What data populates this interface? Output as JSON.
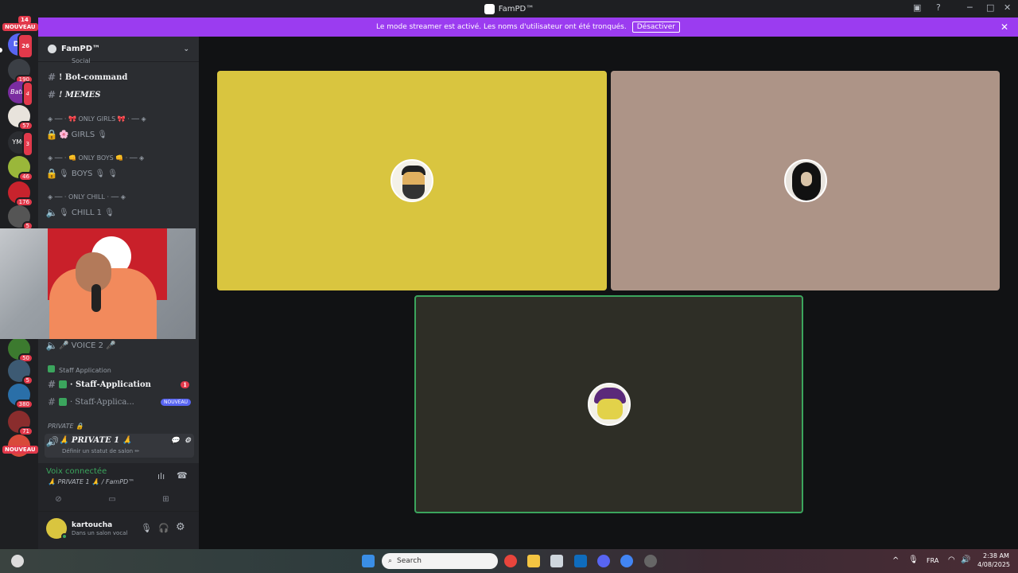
{
  "window": {
    "title": "FamPD™"
  },
  "banner": {
    "message": "Le mode streamer est activé. Les noms d'utilisateur ont été tronqués.",
    "disable_label": "Désactiver",
    "color": "#9b3cf0"
  },
  "servers": {
    "top_badge": "14",
    "nouveau_label": "NOUVEAU",
    "icons": [
      {
        "label": "DR",
        "badge": "26"
      },
      {
        "label": "",
        "badge": "190"
      },
      {
        "label": "Batra",
        "badge": "4"
      },
      {
        "label": "",
        "badge": "57"
      },
      {
        "label": "YMC",
        "badge": "3"
      },
      {
        "label": "",
        "badge": "46"
      },
      {
        "label": "",
        "badge": "176"
      },
      {
        "label": "",
        "badge": "5"
      },
      {
        "label": "",
        "badge": "50"
      },
      {
        "label": "",
        "badge": "5"
      },
      {
        "label": "",
        "badge": "380"
      },
      {
        "label": "",
        "badge": "71"
      }
    ],
    "bottom_nouveau": "NOUVEAU"
  },
  "guild": {
    "name": "FamPD™"
  },
  "channels": {
    "top_cut": "Social",
    "bot_command": "! Bot-command",
    "memes": "! MEMES",
    "cat_only_girls": "◈ ── · 🎀 ONLY GIRLS 🎀 · ── ◈",
    "girls": "🌸 GIRLS 🎙",
    "cat_only_boys": "◈ ── · 👊 ONLY BOYS 👊 · ── ◈",
    "boys": "🎙 BOYS 🎙 🎙",
    "cat_only_chill": "◈ ── · ONLY CHILL · ── ◈",
    "chill1": "🎙 CHILL 1 🎙",
    "voice2": "🎤 VOICE 2 🎤",
    "cat_staff": "Staff Application",
    "staff_app": "· Staff-Application",
    "staff_app_badge": "1",
    "staff_app2": "· Staff-Applica...",
    "staff_app2_tag": "NOUVEAU",
    "cat_private": "PRIVATE 🔒",
    "private1": "🙏 PRIVATE 1 🙏",
    "private1_status": "Définir un statut de salon ✏"
  },
  "voice": {
    "status": "Voix connectée",
    "channel": "🙏 PRIVATE 1 🙏 / FamPD™"
  },
  "user": {
    "name": "kartoucha",
    "status": "Dans un salon vocal"
  },
  "tiles": [
    {
      "color": "#d9c53f",
      "avatar": "bearded-man-avatar"
    },
    {
      "color": "#ad9487",
      "avatar": "singer-avatar"
    },
    {
      "color": "#2e2e26",
      "avatar": "cartoon-cat-avatar",
      "speaking": true
    }
  ],
  "taskbar": {
    "search_placeholder": "Search",
    "lang": "FRA",
    "time": "2:38 AM",
    "date": "4/08/2025"
  }
}
